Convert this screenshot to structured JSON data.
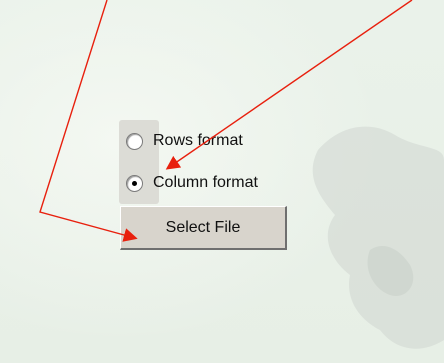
{
  "radio_group": {
    "options": [
      {
        "label": "Rows format",
        "checked": false
      },
      {
        "label": "Column format",
        "checked": true
      }
    ]
  },
  "select_file_button": {
    "label": "Select File"
  },
  "colors": {
    "annotation_arrow": "#e8200e",
    "background": "#e9f2ea"
  }
}
